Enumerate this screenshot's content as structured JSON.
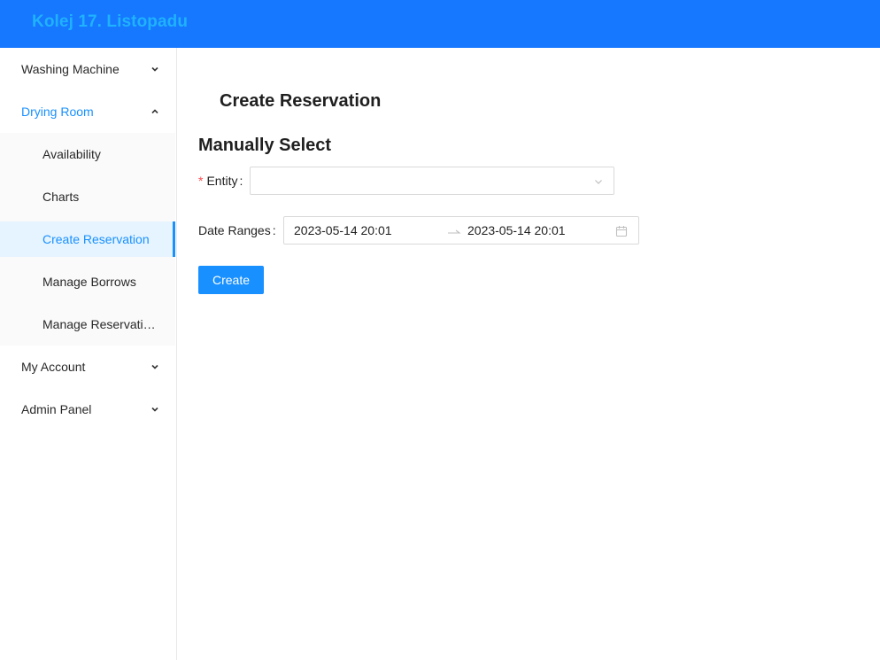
{
  "header": {
    "brand": "Kolej 17. Listopadu",
    "bg_color": "#1677ff",
    "brand_color": "#1fb2ff"
  },
  "sidebar": {
    "menus": [
      {
        "label": "Washing Machine",
        "expanded": false,
        "icon": "chevron-down-icon"
      },
      {
        "label": "Drying Room",
        "expanded": true,
        "icon": "chevron-up-icon",
        "items": [
          {
            "label": "Availability",
            "selected": false
          },
          {
            "label": "Charts",
            "selected": false
          },
          {
            "label": "Create Reservation",
            "selected": true
          },
          {
            "label": "Manage Borrows",
            "selected": false
          },
          {
            "label": "Manage Reservations",
            "selected": false
          }
        ]
      },
      {
        "label": "My Account",
        "expanded": false,
        "icon": "chevron-down-icon"
      },
      {
        "label": "Admin Panel",
        "expanded": false,
        "icon": "chevron-down-icon"
      }
    ],
    "accent_color": "#1890ff"
  },
  "main": {
    "page_title": "Create Reservation",
    "section_title": "Manually Select",
    "form": {
      "entity": {
        "label": "Entity",
        "required": true,
        "value": "",
        "icon": "chevron-down-icon"
      },
      "date_ranges": {
        "label": "Date Ranges",
        "start": "2023-05-14 20:01",
        "end": "2023-05-14 20:01",
        "separator_icon": "arrow-right-icon",
        "icon": "calendar-icon"
      },
      "submit_label": "Create"
    }
  }
}
